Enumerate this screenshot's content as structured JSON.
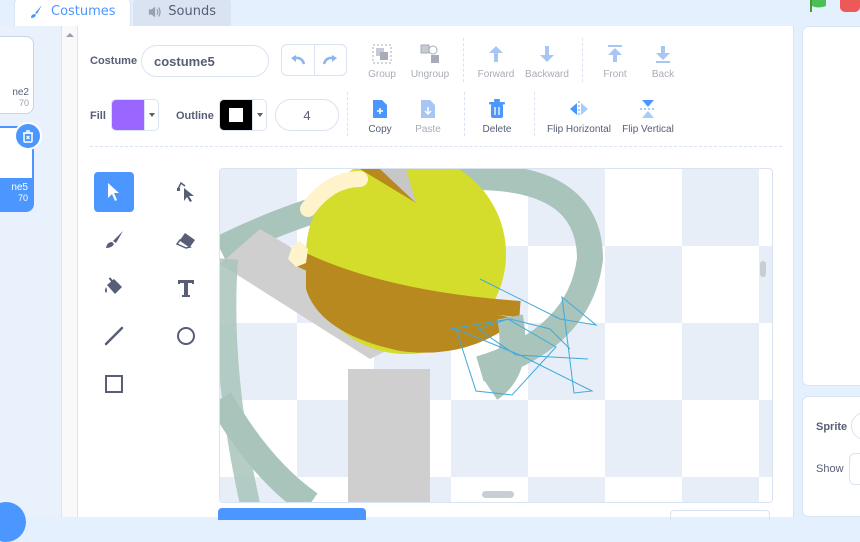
{
  "tabs": {
    "costumes": "Costumes",
    "sounds": "Sounds"
  },
  "costume_list": [
    {
      "name": "ne2",
      "size": "70"
    },
    {
      "name": "ne5",
      "size": "70"
    }
  ],
  "costume_field": {
    "label": "Costume",
    "value": "costume5"
  },
  "fill": {
    "label": "Fill",
    "color": "#9966ff"
  },
  "outline": {
    "label": "Outline",
    "color": "#000000",
    "width": "4"
  },
  "toolbar": {
    "group": "Group",
    "ungroup": "Ungroup",
    "forward": "Forward",
    "backward": "Backward",
    "front": "Front",
    "back": "Back",
    "copy": "Copy",
    "paste": "Paste",
    "delete": "Delete",
    "flip_h": "Flip Horizontal",
    "flip_v": "Flip Vertical"
  },
  "sprite_panel": {
    "sprite_label": "Sprite",
    "show_label": "Show"
  },
  "colors": {
    "accent": "#4c97ff",
    "text": "#575e75",
    "green_flag": "#4cbf56",
    "stop": "#ec5959"
  }
}
